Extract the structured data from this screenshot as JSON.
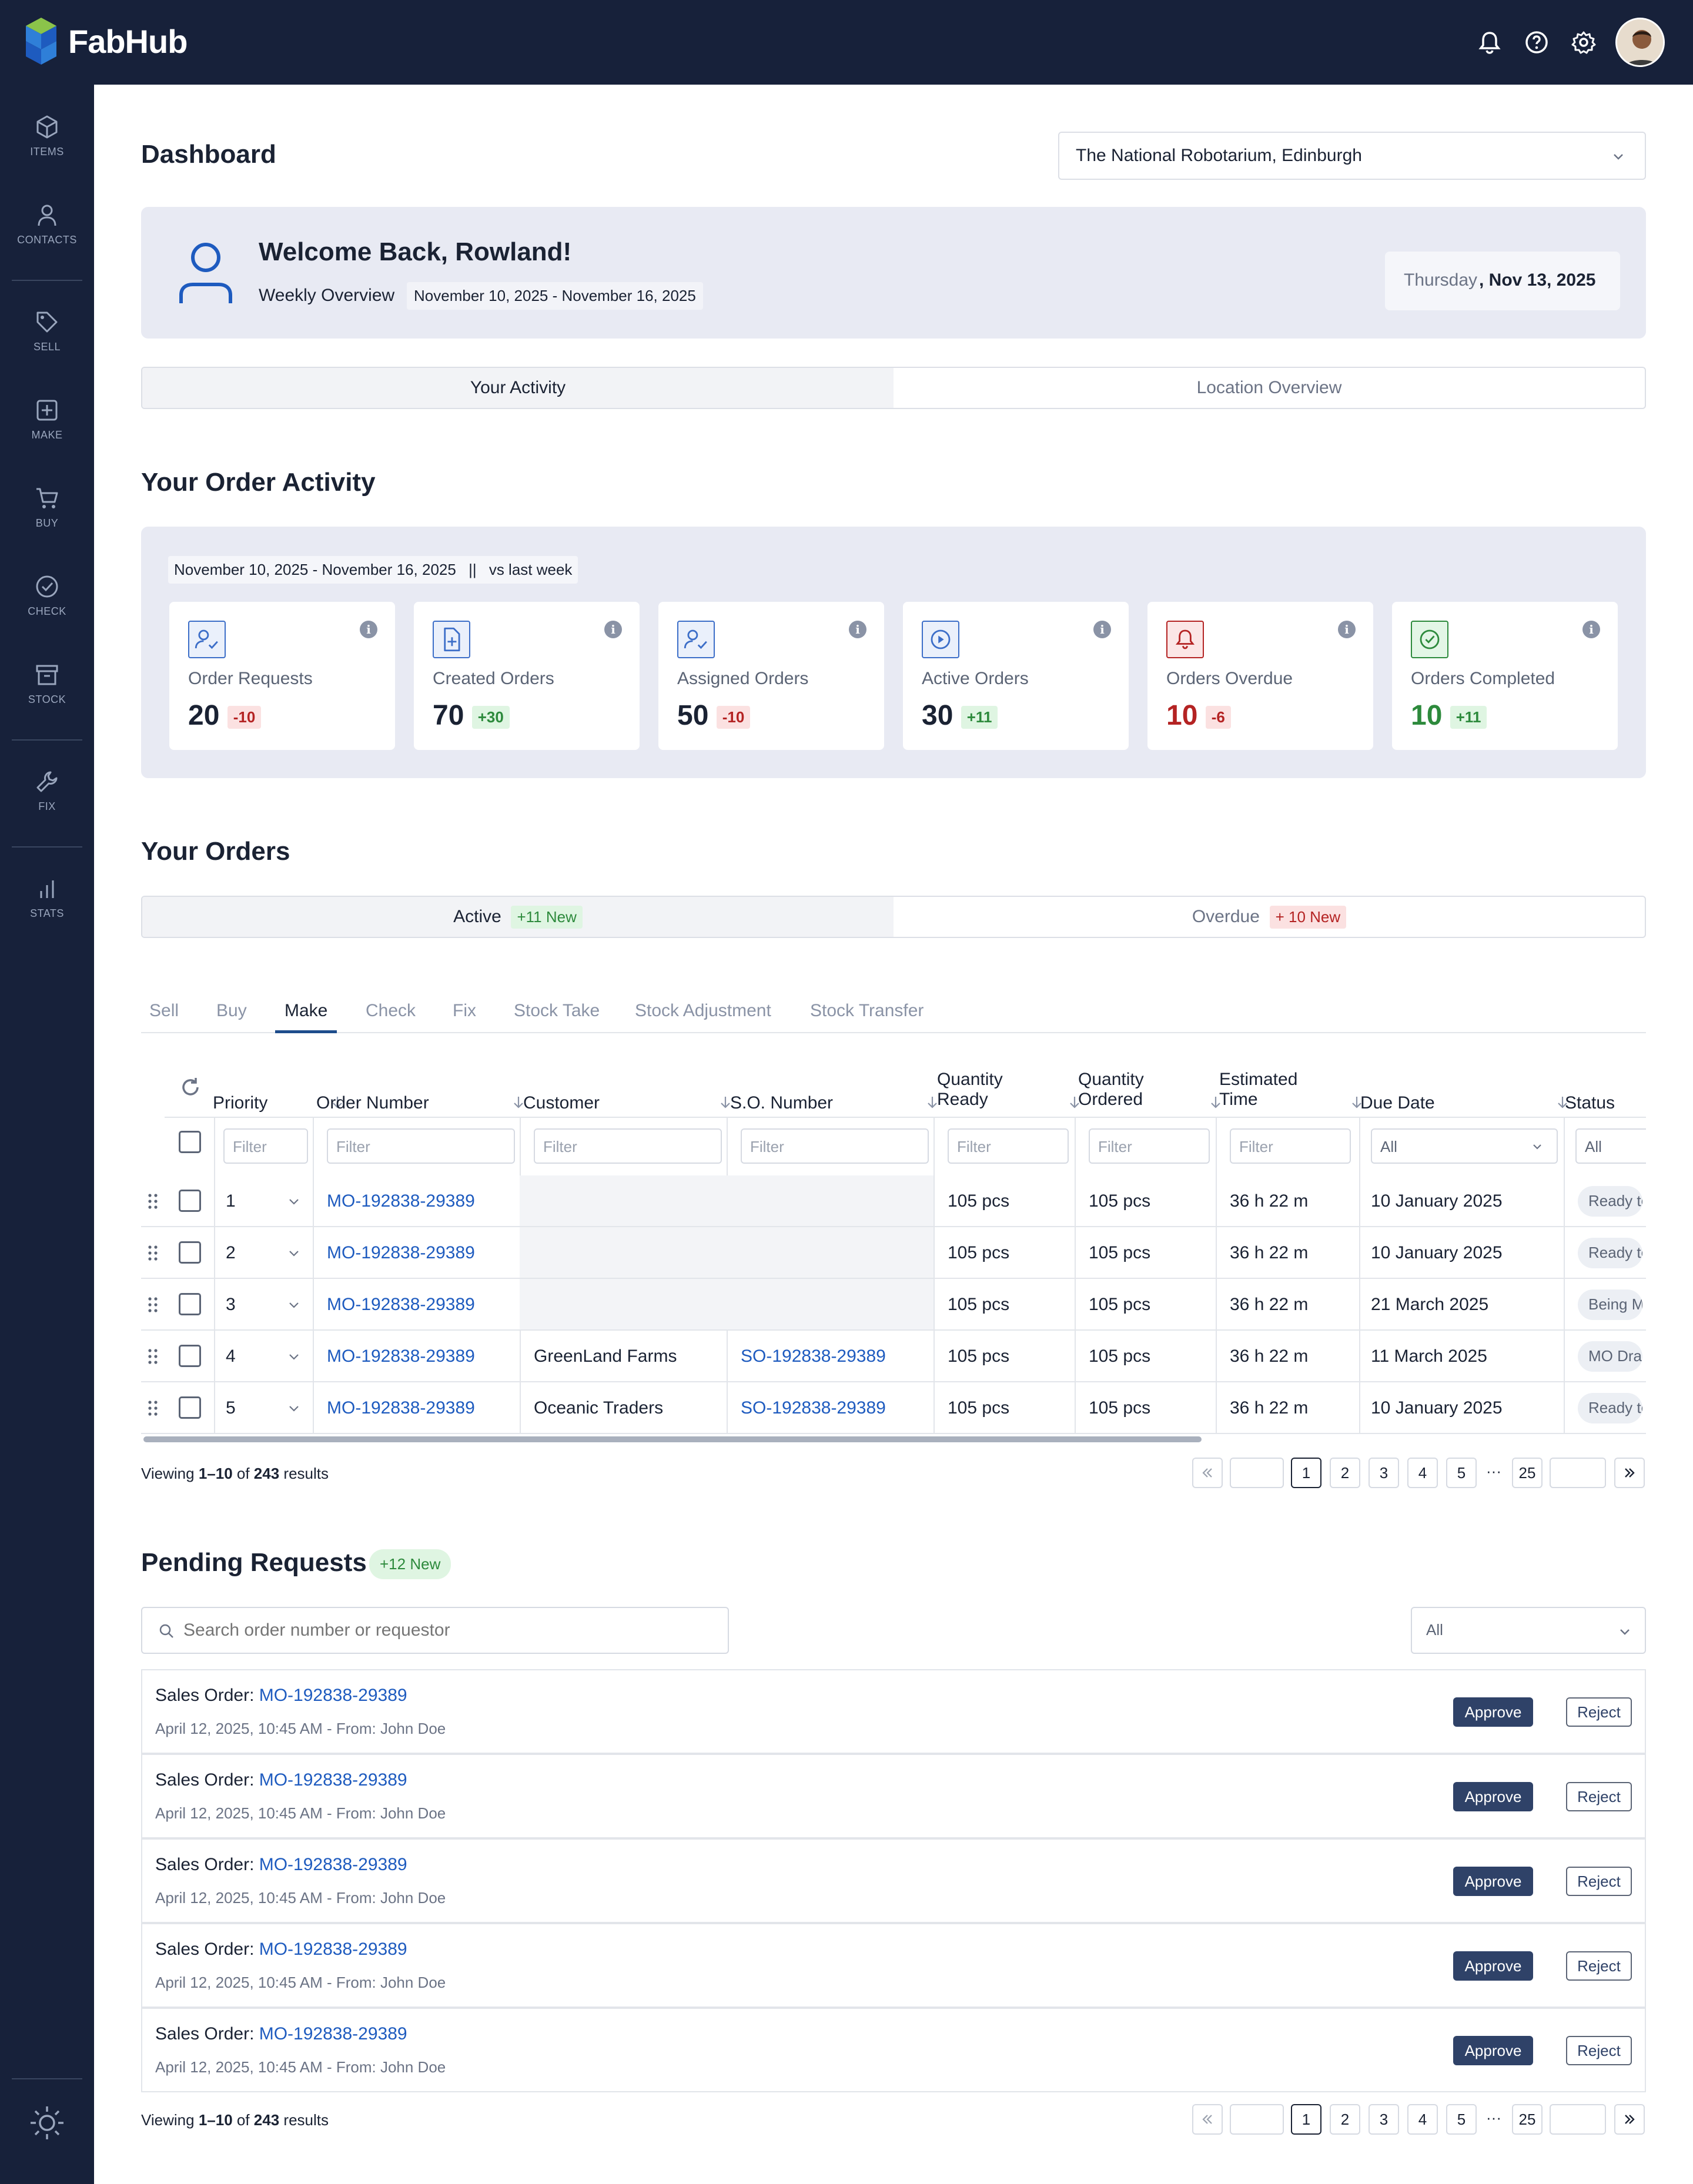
{
  "app": {
    "name": "FabHub"
  },
  "sidebar": {
    "items": [
      {
        "label": "ITEMS",
        "icon": "cube-icon"
      },
      {
        "label": "CONTACTS",
        "icon": "user-icon"
      },
      {
        "label": "SELL",
        "icon": "tag-icon"
      },
      {
        "label": "MAKE",
        "icon": "plus-square-icon"
      },
      {
        "label": "BUY",
        "icon": "cart-icon"
      },
      {
        "label": "CHECK",
        "icon": "check-circle-icon"
      },
      {
        "label": "STOCK",
        "icon": "archive-icon"
      },
      {
        "label": "FIX",
        "icon": "wrench-icon"
      },
      {
        "label": "STATS",
        "icon": "bar-chart-icon"
      }
    ]
  },
  "header": {
    "title": "Dashboard",
    "location": "The National Robotarium, Edinburgh"
  },
  "welcome": {
    "title": "Welcome Back, Rowland!",
    "subtitle": "Weekly Overview",
    "range": "November 10, 2025 - November 16, 2025",
    "day": "Thursday",
    "date": ", Nov 13, 2025"
  },
  "view_tabs": [
    "Your Activity",
    "Location Overview"
  ],
  "activity": {
    "title": "Your Order Activity",
    "range": "November 10, 2025 - November 16, 2025",
    "sep": "||",
    "compare": "vs last week",
    "stats": [
      {
        "label": "Order Requests",
        "value": "20",
        "delta": "-10",
        "tone": "neg",
        "icon": "user-check-icon"
      },
      {
        "label": "Created Orders",
        "value": "70",
        "delta": "+30",
        "tone": "pos",
        "icon": "file-plus-icon"
      },
      {
        "label": "Assigned Orders",
        "value": "50",
        "delta": "-10",
        "tone": "neg",
        "icon": "user-check-icon"
      },
      {
        "label": "Active Orders",
        "value": "30",
        "delta": "+11",
        "tone": "pos",
        "icon": "play-circle-icon"
      },
      {
        "label": "Orders Overdue",
        "value": "10",
        "delta": "-6",
        "tone": "neg",
        "icon": "bell-icon"
      },
      {
        "label": "Orders Completed",
        "value": "10",
        "delta": "+11",
        "tone": "pos",
        "icon": "check-circle-icon"
      }
    ]
  },
  "orders": {
    "title": "Your Orders",
    "active_label": "Active",
    "active_badge": "+11 New",
    "overdue_label": "Overdue",
    "overdue_badge": "+ 10 New",
    "tabs": [
      "Sell",
      "Buy",
      "Make",
      "Check",
      "Fix",
      "Stock Take",
      "Stock Adjustment",
      "Stock Transfer"
    ],
    "columns": [
      "Priority",
      "Order Number",
      "Customer",
      "S.O. Number",
      "Quantity\nReady",
      "Quantity\nOrdered",
      "Estimated\nTime",
      "Due Date",
      "Status"
    ],
    "filter_placeholder": "Filter",
    "all_label": "All",
    "rows": [
      {
        "priority": "1",
        "order": "MO-192838-29389",
        "customer": "",
        "so": "",
        "ready": "105 pcs",
        "ordered": "105 pcs",
        "time": "36 h 22 m",
        "due": "10 January 2025",
        "status": "Ready to"
      },
      {
        "priority": "2",
        "order": "MO-192838-29389",
        "customer": "",
        "so": "",
        "ready": "105 pcs",
        "ordered": "105 pcs",
        "time": "36 h 22 m",
        "due": "10 January 2025",
        "status": "Ready to"
      },
      {
        "priority": "3",
        "order": "MO-192838-29389",
        "customer": "",
        "so": "",
        "ready": "105 pcs",
        "ordered": "105 pcs",
        "time": "36 h 22 m",
        "due": "21 March 2025",
        "status": "Being M"
      },
      {
        "priority": "4",
        "order": "MO-192838-29389",
        "customer": "GreenLand Farms",
        "so": "SO-192838-29389",
        "ready": "105 pcs",
        "ordered": "105 pcs",
        "time": "36 h 22 m",
        "due": "11 March 2025",
        "status": "MO Dra"
      },
      {
        "priority": "5",
        "order": "MO-192838-29389",
        "customer": "Oceanic Traders",
        "so": "SO-192838-29389",
        "ready": "105 pcs",
        "ordered": "105 pcs",
        "time": "36 h 22 m",
        "due": "10 January 2025",
        "status": "Ready to"
      }
    ],
    "viewing": {
      "prefix": "Viewing ",
      "range": "1–10",
      "of": " of ",
      "total": "243",
      "suffix": " results"
    }
  },
  "pager": {
    "pages": [
      "1",
      "2",
      "3",
      "4",
      "5"
    ],
    "ellipsis": "···",
    "last": "25",
    "current": "1"
  },
  "pending": {
    "title": "Pending Requests",
    "badge": "+12 New",
    "search_placeholder": "Search order number or requestor",
    "filter": "All",
    "approve": "Approve",
    "reject": "Reject",
    "items": [
      {
        "prefix": "Sales Order: ",
        "order": "MO-192838-29389",
        "meta": "April 12, 2025, 10:45 AM - From: John Doe"
      },
      {
        "prefix": "Sales Order: ",
        "order": "MO-192838-29389",
        "meta": "April 12, 2025, 10:45 AM - From: John Doe"
      },
      {
        "prefix": "Sales Order: ",
        "order": "MO-192838-29389",
        "meta": "April 12, 2025, 10:45 AM - From: John Doe"
      },
      {
        "prefix": "Sales Order: ",
        "order": "MO-192838-29389",
        "meta": "April 12, 2025, 10:45 AM - From: John Doe"
      },
      {
        "prefix": "Sales Order: ",
        "order": "MO-192838-29389",
        "meta": "April 12, 2025, 10:45 AM - From: John Doe"
      }
    ],
    "viewing": {
      "prefix": "Viewing ",
      "range": "1–10",
      "of": " of ",
      "total": "243",
      "suffix": " results"
    }
  },
  "colors": {
    "navy": "#17213a",
    "accent": "#1e5bbf",
    "approve": "#2f4268",
    "neg": "#b42323",
    "pos": "#2d8a3c"
  }
}
